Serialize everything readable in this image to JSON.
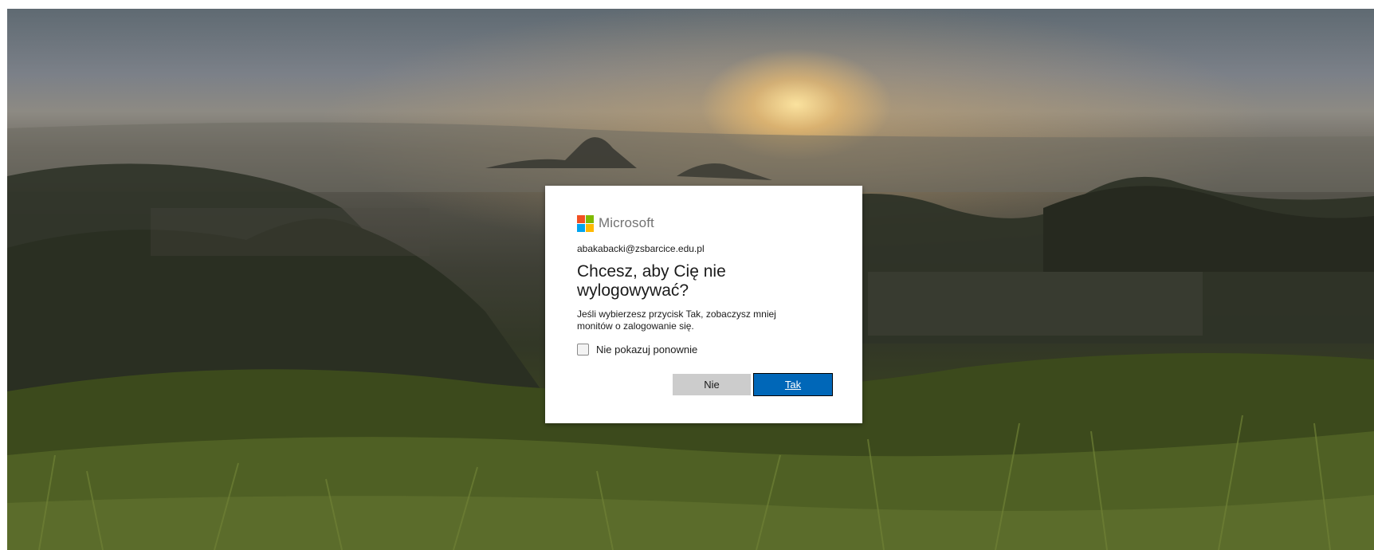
{
  "brand": {
    "name": "Microsoft",
    "logo_colors": [
      "#f25022",
      "#7fba00",
      "#00a4ef",
      "#ffb900"
    ]
  },
  "account": {
    "email": "abakabacki@zsbarcice.edu.pl"
  },
  "dialog": {
    "title": "Chcesz, aby Cię nie wylogowywać?",
    "description": "Jeśli wybierzesz przycisk Tak, zobaczysz mniej monitów o zalogowanie się.",
    "checkbox_label": "Nie pokazuj ponownie",
    "checkbox_checked": false
  },
  "buttons": {
    "no_label": "Nie",
    "yes_label": "Tak"
  },
  "colors": {
    "primary_button": "#0067b8",
    "secondary_button": "#cccccc"
  }
}
